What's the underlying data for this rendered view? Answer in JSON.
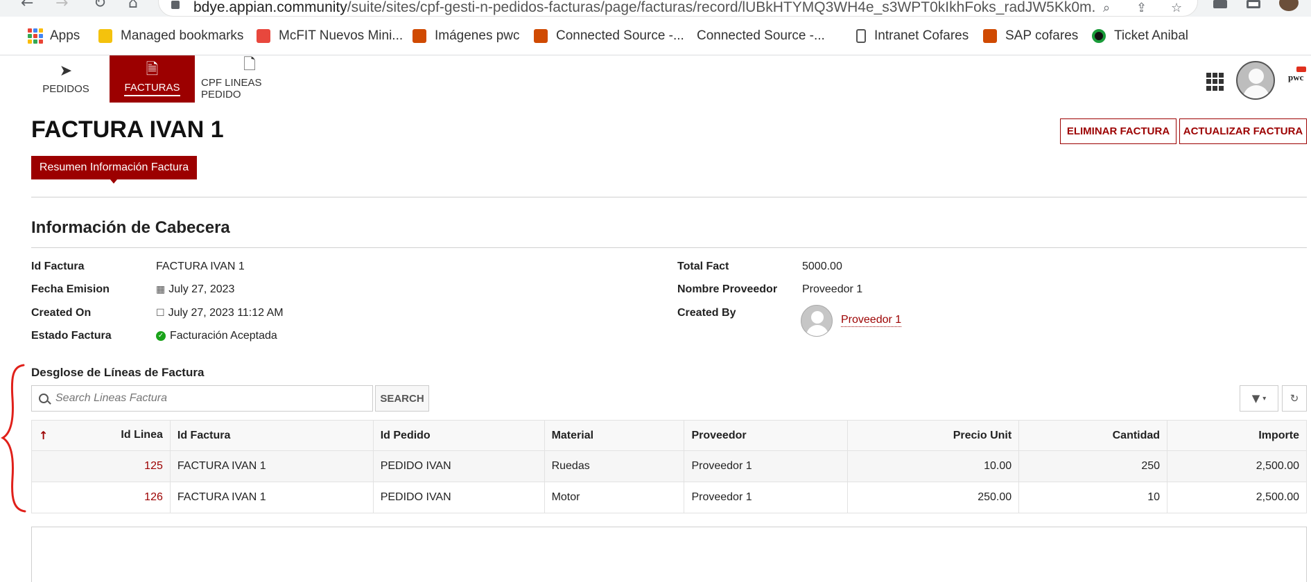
{
  "browser": {
    "url_host": "bdye.appian.community",
    "url_path": "/suite/sites/cpf-gesti-n-pedidos-facturas/page/facturas/record/lUBkHTYMQ3WH4e_s3WPT0kIkhFoks_radJW5Kk0m..."
  },
  "bookmarks": [
    {
      "label": "Apps",
      "icon": "apps-grid-icon",
      "color": "#4285f4"
    },
    {
      "label": "Managed bookmarks",
      "icon": "folder-icon",
      "color": "#f4c20d"
    },
    {
      "label": "McFIT Nuevos Mini...",
      "icon": "mcfit-icon",
      "color": "#e8473d"
    },
    {
      "label": "Imágenes pwc",
      "icon": "pwc-icon",
      "color": "#d04a02"
    },
    {
      "label": "Connected Source -...",
      "icon": "pwc-icon",
      "color": "#d04a02"
    },
    {
      "label": "Connected Source -...",
      "icon": "none",
      "color": "#ffffff"
    },
    {
      "label": "Intranet Cofares",
      "icon": "page-icon",
      "color": "#555555"
    },
    {
      "label": "SAP cofares",
      "icon": "pwc-icon",
      "color": "#d04a02"
    },
    {
      "label": "Ticket Anibal",
      "icon": "ticket-icon",
      "color": "#1a9c3a"
    }
  ],
  "nav": {
    "tabs": [
      {
        "label": "PEDIDOS",
        "icon": "paper-plane-icon"
      },
      {
        "label": "FACTURAS",
        "icon": "invoice-icon"
      },
      {
        "label": "CPF LINEAS PEDIDO",
        "icon": "document-icon"
      }
    ],
    "active": "FACTURAS",
    "brand": "pwc"
  },
  "page": {
    "title": "FACTURA IVAN 1",
    "delete_label": "ELIMINAR FACTURA",
    "update_label": "ACTUALIZAR FACTURA",
    "summary_tab": "Resumen Información Factura",
    "section_title": "Información de Cabecera"
  },
  "fields": {
    "id_factura": {
      "label": "Id Factura",
      "value": "FACTURA IVAN 1"
    },
    "fecha_emision": {
      "label": "Fecha Emision",
      "value": "July 27, 2023"
    },
    "created_on": {
      "label": "Created On",
      "value": "July 27, 2023 11:12 AM"
    },
    "estado": {
      "label": "Estado Factura",
      "value": "Facturación Aceptada"
    },
    "total": {
      "label": "Total Fact",
      "value": "5000.00"
    },
    "proveedor": {
      "label": "Nombre Proveedor",
      "value": "Proveedor 1"
    },
    "created_by": {
      "label": "Created By",
      "value": "Proveedor 1"
    }
  },
  "grid": {
    "title": "Desglose de Líneas de Factura",
    "search_placeholder": "Search Lineas Factura",
    "search_label": "SEARCH",
    "headers": [
      "Id Linea",
      "Id Factura",
      "Id Pedido",
      "Material",
      "Proveedor",
      "Precio Unit",
      "Cantidad",
      "Importe"
    ],
    "rows": [
      [
        "125",
        "FACTURA IVAN 1",
        "PEDIDO IVAN",
        "Ruedas",
        "Proveedor 1",
        "10.00",
        "250",
        "2,500.00"
      ],
      [
        "126",
        "FACTURA IVAN 1",
        "PEDIDO IVAN",
        "Motor",
        "Proveedor 1",
        "250.00",
        "10",
        "2,500.00"
      ]
    ]
  },
  "colors": {
    "accent": "#9c0000",
    "success": "#1aa31a",
    "annotation": "#e0201a"
  }
}
